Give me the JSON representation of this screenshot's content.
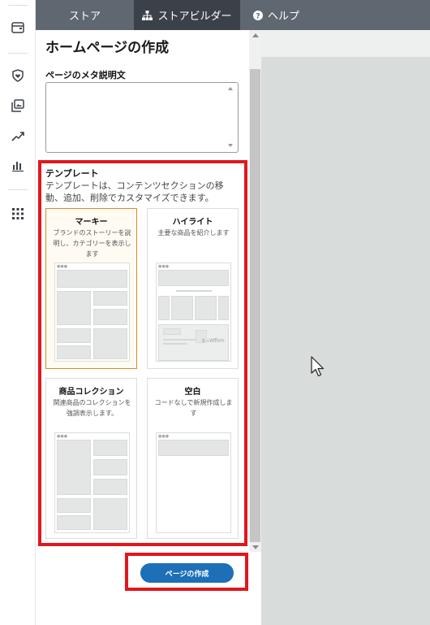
{
  "nav": {
    "tabs": [
      {
        "label": "ストア"
      },
      {
        "label": "ストアビルダー"
      },
      {
        "label": "ヘルプ"
      }
    ]
  },
  "rail": {
    "icons": [
      "wallet-icon",
      "shield-heart-icon",
      "gallery-icon",
      "trend-icon",
      "bar-chart-icon",
      "apps-grid-icon"
    ]
  },
  "page": {
    "title": "ホームページの作成",
    "meta_label": "ページのメタ説明文",
    "meta_value": ""
  },
  "templates": {
    "title": "テンプレート",
    "description": "テンプレートは、コンテンツセクションの移動、追加、削除でカスタマイズできます。",
    "cards": [
      {
        "title": "マーキー",
        "desc": "ブランドのストーリーを説明し、カテゴリーを表示します",
        "selected": true
      },
      {
        "title": "ハイライト",
        "desc": "主要な商品を紹介します",
        "thumb_text": "$ √Affirm"
      },
      {
        "title": "商品コレクション",
        "desc": "関連商品のコレクションを強調表示します。"
      },
      {
        "title": "空白",
        "desc": "コードなしで新規作成します"
      }
    ]
  },
  "actions": {
    "create_label": "ページの作成"
  },
  "colors": {
    "nav_bg": "#5f6771",
    "nav_active": "#3b4149",
    "highlight": "#e0171e",
    "button": "#1d6fb8",
    "selected_border": "#d98a2b"
  }
}
